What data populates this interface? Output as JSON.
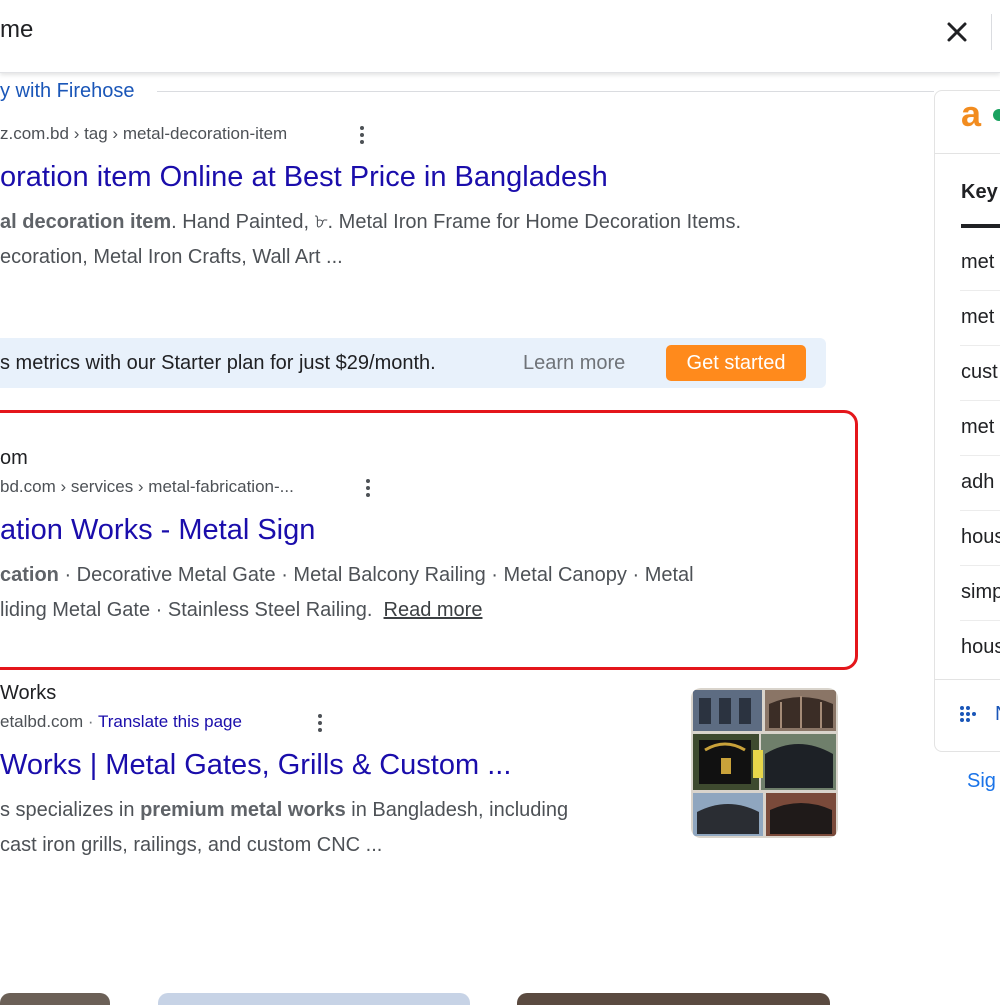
{
  "search": {
    "query": "me"
  },
  "firehose": {
    "label": "y with Firehose"
  },
  "results": [
    {
      "breadcrumb": "z.com.bd › tag › metal-decoration-item",
      "title": "oration item Online at Best Price in Bangladesh",
      "snippet_line1_bold": "al decoration item",
      "snippet_line1_rest": ". Hand Painted, ৮. Metal Iron Frame for Home Decoration Items.",
      "snippet_line2": "ecoration, Metal Iron Crafts, Wall Art ..."
    },
    {
      "site_name": "om",
      "breadcrumb": "bd.com › services › metal-fabrication-...",
      "title": "ation Works - Metal Sign",
      "snippet_line1_bold": "cation",
      "snippet_line1_rest": " · Decorative Metal Gate · Metal Balcony Railing · Metal Canopy · Metal",
      "snippet_line2": "liding Metal Gate · Stainless Steel Railing.",
      "read_more": "Read more"
    },
    {
      "site_name": "Works",
      "breadcrumb": "etalbd.com",
      "translate": "Translate this page",
      "title": "Works | Metal Gates, Grills & Custom ...",
      "snippet_line1_pre": "s specializes in ",
      "snippet_line1_bold": "premium metal works",
      "snippet_line1_rest": " in Bangladesh, including",
      "snippet_line2": "cast iron grills, railings, and custom CNC ..."
    }
  ],
  "promo": {
    "text": "s metrics with our Starter plan for just $29/month.",
    "learn_more": "Learn more",
    "cta": "Get started",
    "cta_color": "#ff8a1c"
  },
  "side_panel": {
    "logo": "a",
    "heading": "Key",
    "keywords": [
      "met",
      "met",
      "cust",
      "met",
      "adh",
      "hous",
      "simp",
      "hous"
    ],
    "footer": "N"
  },
  "sign_in": "Sig",
  "colors": {
    "link": "#1a0dab",
    "highlight": "#e4161b",
    "accent_orange": "#ff8a1c",
    "banner_bg": "#e8f1fb"
  },
  "icons": [
    "close-icon",
    "more-vert-icon",
    "apps-grid-icon"
  ]
}
